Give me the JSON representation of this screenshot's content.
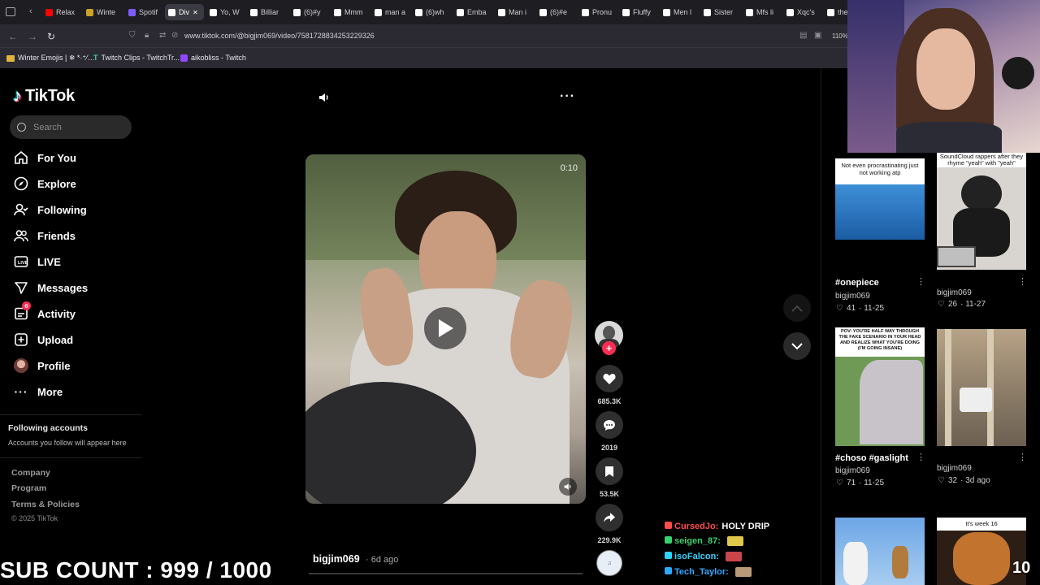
{
  "browser": {
    "tabs": [
      {
        "label": "Relax",
        "color": "#ff0000"
      },
      {
        "label": "Winte",
        "color": "#c9a227"
      },
      {
        "label": "Spotif",
        "color": "#7c5cff"
      },
      {
        "label": "Div",
        "color": "#ffffff",
        "active": true
      },
      {
        "label": "Yo, W",
        "color": "#ffffff"
      },
      {
        "label": "Billiar",
        "color": "#ffffff"
      },
      {
        "label": "(6)#y",
        "color": "#ffffff"
      },
      {
        "label": "Mmm",
        "color": "#ffffff"
      },
      {
        "label": "man a",
        "color": "#ffffff"
      },
      {
        "label": "(6)wh",
        "color": "#ffffff"
      },
      {
        "label": "Emba",
        "color": "#ffffff"
      },
      {
        "label": "Man i",
        "color": "#ffffff"
      },
      {
        "label": "(6)#e",
        "color": "#ffffff"
      },
      {
        "label": "Pronu",
        "color": "#ffffff"
      },
      {
        "label": "Fluffy",
        "color": "#ffffff"
      },
      {
        "label": "Men l",
        "color": "#ffffff"
      },
      {
        "label": "Sister",
        "color": "#ffffff"
      },
      {
        "label": "Mfs li",
        "color": "#ffffff"
      },
      {
        "label": "Xqc's",
        "color": "#ffffff"
      },
      {
        "label": "the",
        "color": "#ffffff"
      }
    ],
    "url": "www.tiktok.com/@bigjim069/video/7581728834253229326",
    "zoom": "110%",
    "bookmarks": [
      "Winter Emojis | ❄ *·⁺⁄…",
      "Twitch Clips - TwitchTr...",
      "aikobliss - Twitch"
    ]
  },
  "tiktok": {
    "brand": "TikTok",
    "search_placeholder": "Search",
    "nav": [
      {
        "label": "For You",
        "icon": "home-icon"
      },
      {
        "label": "Explore",
        "icon": "compass-icon"
      },
      {
        "label": "Following",
        "icon": "following-icon"
      },
      {
        "label": "Friends",
        "icon": "friends-icon"
      },
      {
        "label": "LIVE",
        "icon": "live-icon"
      },
      {
        "label": "Messages",
        "icon": "messages-icon"
      },
      {
        "label": "Activity",
        "icon": "activity-icon",
        "badge": "6"
      },
      {
        "label": "Upload",
        "icon": "upload-icon"
      },
      {
        "label": "Profile",
        "icon": "profile-avatar"
      },
      {
        "label": "More",
        "icon": "more-icon"
      }
    ],
    "following_title": "Following accounts",
    "following_note": "Accounts you follow will appear here",
    "footer": [
      "Company",
      "Program",
      "Terms & Policies"
    ],
    "copyright": "© 2025 TikTok"
  },
  "video": {
    "time": "0:10",
    "author": "bigjim069",
    "age": "· 6d ago",
    "likes": "685.3K",
    "comments": "2019",
    "saves": "53.5K",
    "shares": "229.9K"
  },
  "recommendations": [
    {
      "caption": "Not even procrastinating just not working atp",
      "title": "#onepiece",
      "user": "bigjim069",
      "likes": "41",
      "date": "· 11-25"
    },
    {
      "caption": "SoundCloud rappers after they rhyme \"yeah\" with \"yeah\"",
      "title": "",
      "user": "bigjim069",
      "likes": "26",
      "date": "· 11-27"
    },
    {
      "caption": "POV: YOU'RE HALF WAY THROUGH THE FAKE SCENARIO IN YOUR HEAD AND REALIZE WHAT YOU'RE DOING (I'M GOING INSANE)",
      "title": "#choso #gaslight",
      "user": "bigjim069",
      "likes": "71",
      "date": "· 11-25"
    },
    {
      "caption": "",
      "title": "",
      "user": "bigjim069",
      "likes": "32",
      "date": "· 3d ago"
    },
    {
      "caption": "",
      "title": "",
      "user": "",
      "likes": "",
      "date": ""
    },
    {
      "caption": "It's week 16",
      "title": "",
      "user": "",
      "likes": "",
      "date": ""
    }
  ],
  "overlay": {
    "sub_count": "SUB COUNT : 999 / 1000",
    "chat": [
      {
        "name": "CursedJo:",
        "msg": "HOLY DRIP",
        "color": "#ff4d4d"
      },
      {
        "name": "seigen_87:",
        "msg": "",
        "color": "#3bd16f"
      },
      {
        "name": "isoFalcon:",
        "msg": "",
        "color": "#2fd3ff"
      },
      {
        "name": "Tech_Taylor:",
        "msg": "",
        "color": "#2fa8ff"
      }
    ],
    "corner_count": "10"
  }
}
